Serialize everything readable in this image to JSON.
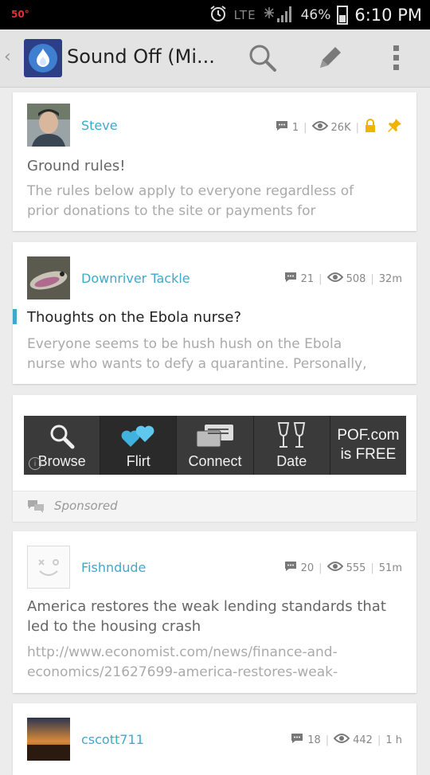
{
  "status_bar": {
    "temperature": "50°",
    "network": "LTE",
    "battery": "46%",
    "time": "6:10 PM"
  },
  "action_bar": {
    "back_glyph": "‹",
    "title": "Sound Off (Mi..."
  },
  "posts": [
    {
      "author": "Steve",
      "comments": "1",
      "views": "26K",
      "title": "Ground rules!",
      "snippet_line1": "The rules below apply to everyone regardless of",
      "snippet_line2": "prior donations to the site or payments for"
    },
    {
      "author": "Downriver Tackle",
      "comments": "21",
      "views": "508",
      "age": "32m",
      "title": "Thoughts on the Ebola nurse?",
      "snippet_line1": "Everyone seems to be hush hush on the Ebola",
      "snippet_line2": "nurse who wants to defy a quarantine. Personally,"
    },
    {
      "author": "Fishndude",
      "comments": "20",
      "views": "555",
      "age": "51m",
      "title_line1": "America restores the weak lending standards that",
      "title_line2": "led to the housing crash",
      "snippet_line1": "http://www.economist.com/news/finance-and-",
      "snippet_line2": "economics/21627699-america-restores-weak-"
    },
    {
      "author": "cscott711",
      "comments": "18",
      "views": "442",
      "age": "1 h"
    }
  ],
  "ad": {
    "items": [
      "Browse",
      "Flirt",
      "Connect",
      "Date"
    ],
    "pof_line1": "POF.com",
    "pof_line2": "is FREE",
    "sponsored_label": "Sponsored"
  },
  "colors": {
    "accent": "#3fa9c9",
    "lock": "#f0b400",
    "pin": "#f0b400",
    "highlight_bar": "#3fa9c9"
  }
}
